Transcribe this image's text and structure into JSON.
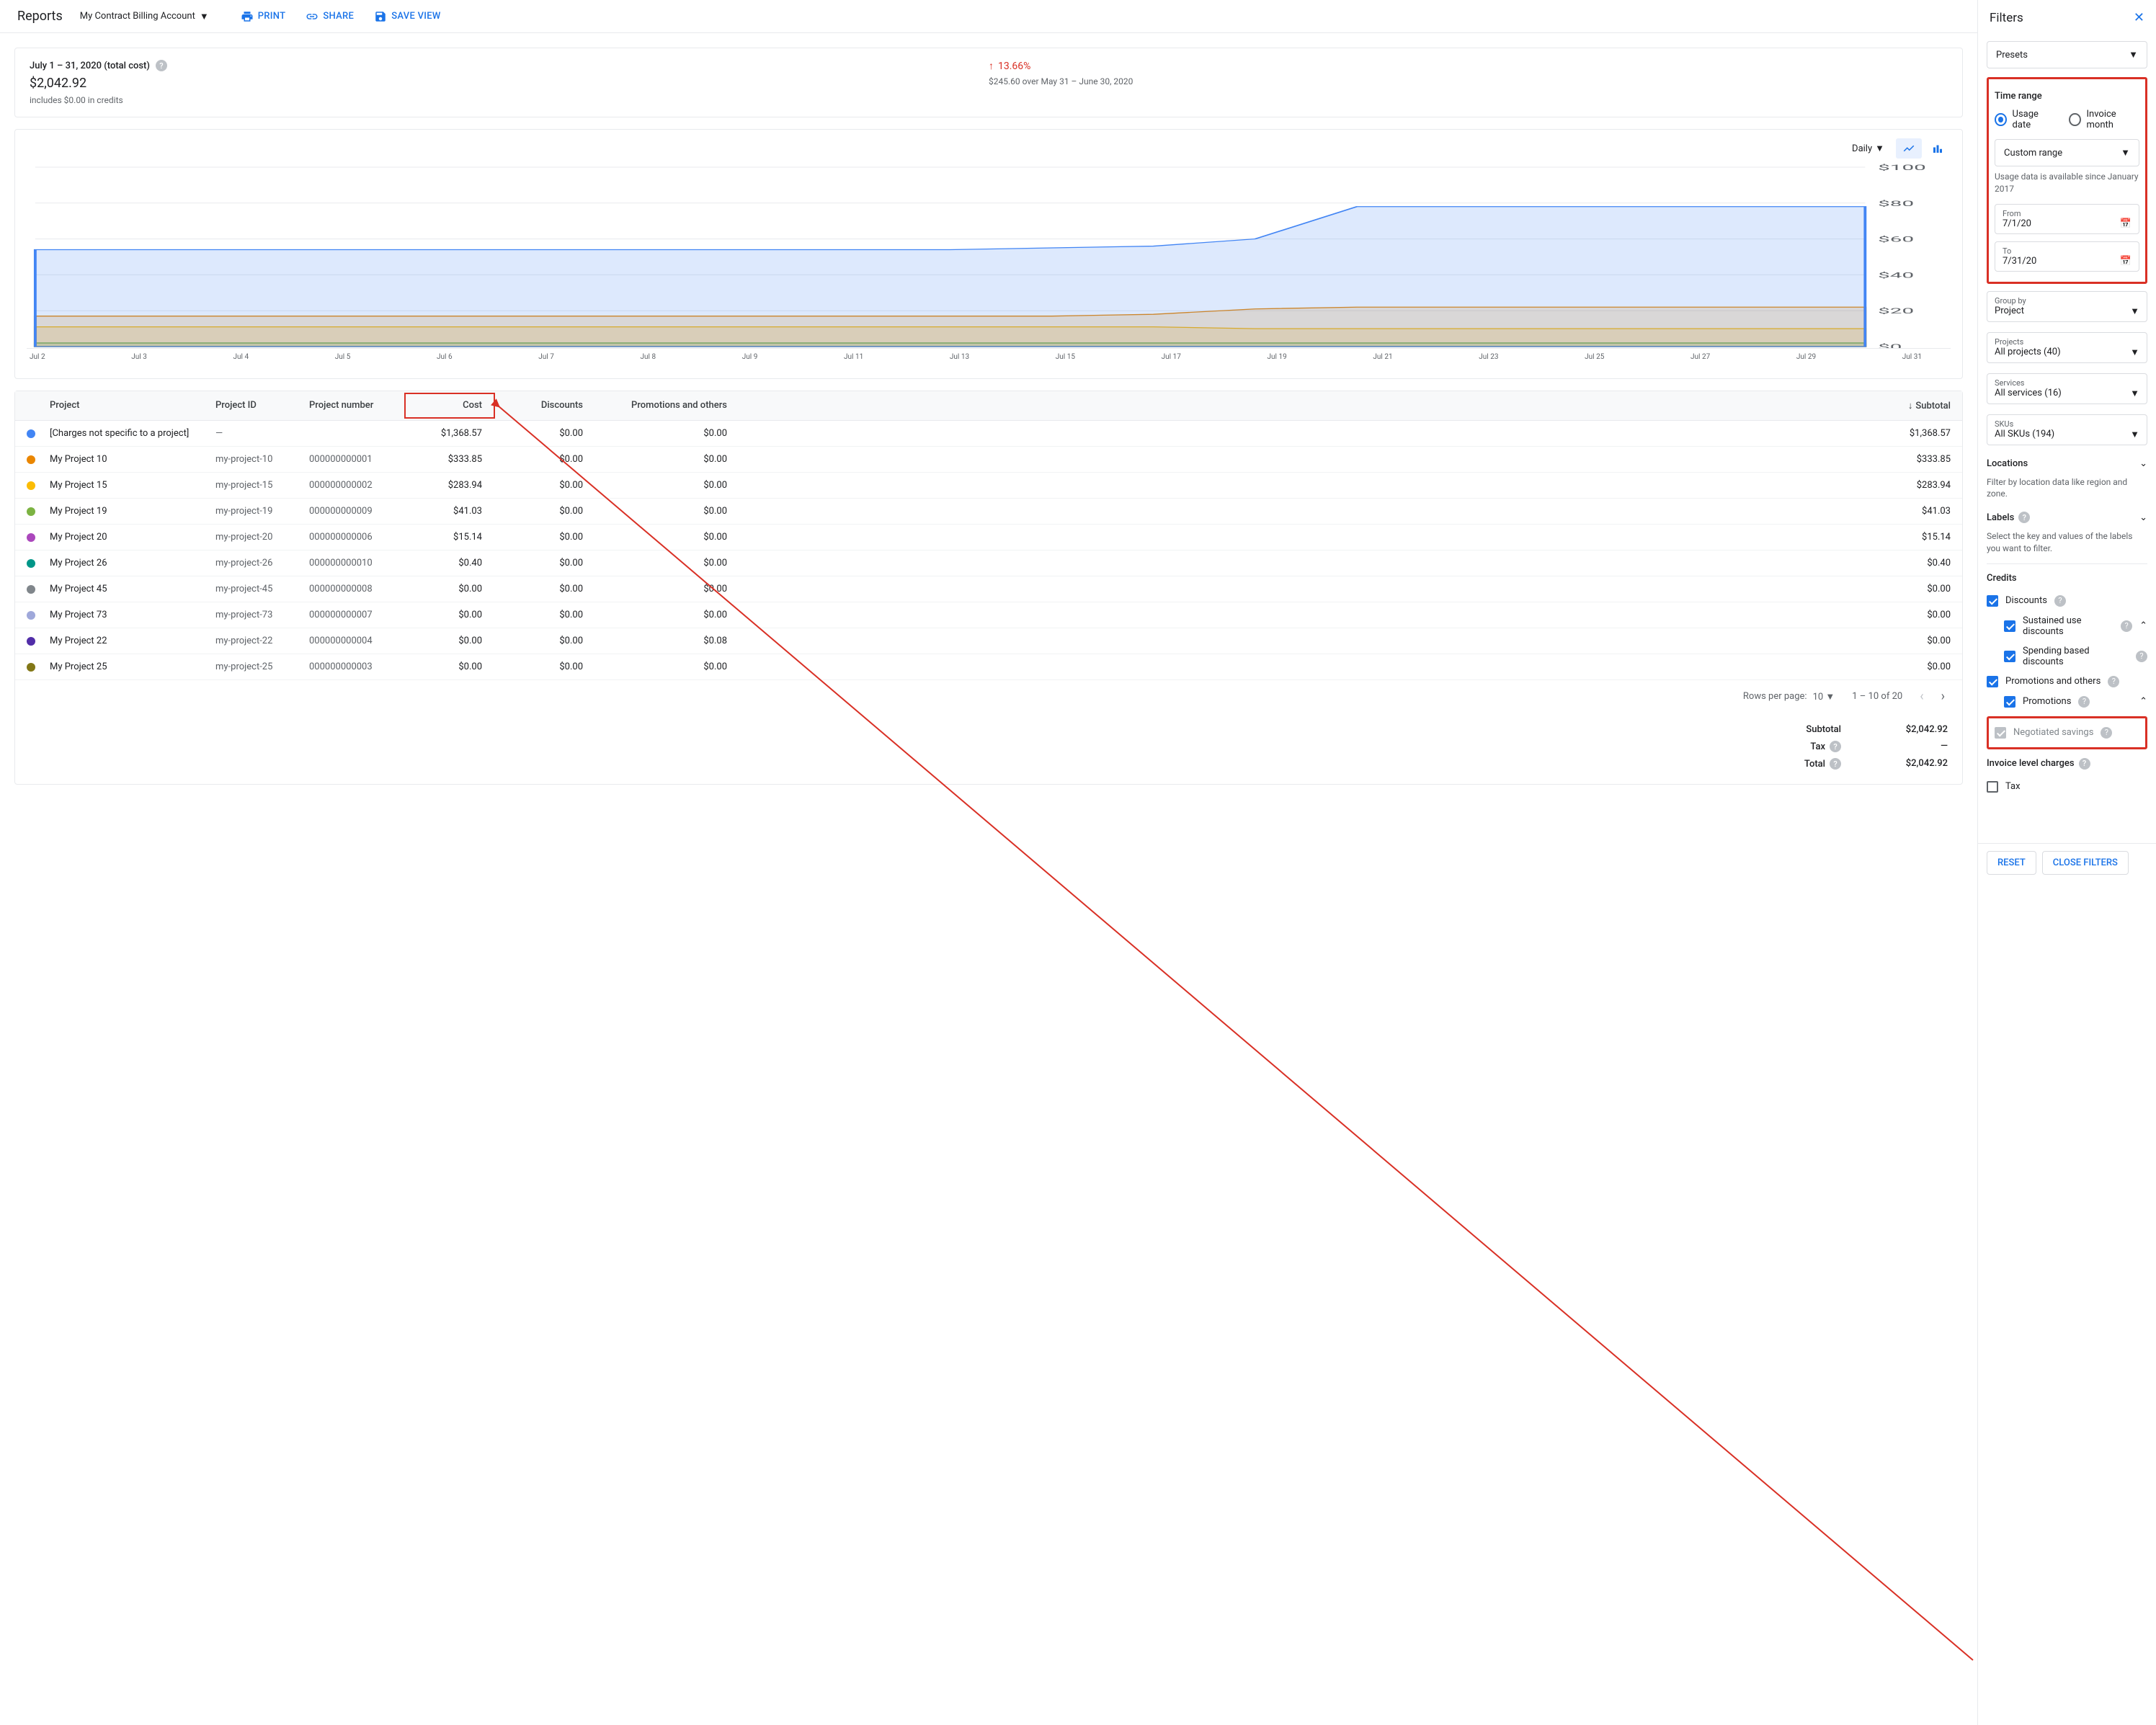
{
  "header": {
    "title": "Reports",
    "account": "My Contract Billing Account",
    "print": "PRINT",
    "share": "SHARE",
    "save_view": "SAVE VIEW"
  },
  "summary": {
    "range_title": "July 1 – 31, 2020 (total cost)",
    "amount": "$2,042.92",
    "credits_note": "includes $0.00 in credits",
    "trend_pct": "13.66%",
    "trend_sub": "$245.60 over May 31 – June 30, 2020"
  },
  "chart_toolbar": {
    "granularity": "Daily"
  },
  "chart_data": {
    "type": "area",
    "ylabel": "$",
    "ylim": [
      0,
      100
    ],
    "yticks": [
      "$0",
      "$20",
      "$40",
      "$60",
      "$80",
      "$100"
    ],
    "x": [
      "Jul 2",
      "Jul 3",
      "Jul 4",
      "Jul 5",
      "Jul 6",
      "Jul 7",
      "Jul 8",
      "Jul 9",
      "Jul 11",
      "Jul 13",
      "Jul 15",
      "Jul 17",
      "Jul 19",
      "Jul 21",
      "Jul 23",
      "Jul 25",
      "Jul 27",
      "Jul 29",
      "Jul 31"
    ],
    "series": [
      {
        "name": "[Charges not specific to a project]",
        "color": "#4285f4",
        "values": [
          54,
          54,
          54,
          54,
          54,
          54,
          54,
          54,
          54,
          54,
          55,
          56,
          60,
          78,
          78,
          78,
          78,
          78,
          78
        ]
      },
      {
        "name": "My Project 10",
        "color": "#ea8600",
        "values": [
          17,
          17,
          17,
          17,
          17,
          17,
          17,
          17,
          17,
          17,
          17,
          18,
          21,
          22,
          22,
          22,
          22,
          22,
          22
        ]
      },
      {
        "name": "My Project 15",
        "color": "#fbbc04",
        "values": [
          11,
          11,
          11,
          11,
          11,
          11,
          11,
          11,
          11,
          11,
          11,
          11,
          10,
          10,
          10,
          10,
          10,
          10,
          10
        ]
      },
      {
        "name": "My Project 19",
        "color": "#34a853",
        "values": [
          2,
          2,
          2,
          2,
          2,
          2,
          2,
          2,
          2,
          2,
          2,
          2,
          2,
          2,
          2,
          2,
          2,
          2,
          2
        ]
      }
    ]
  },
  "table": {
    "headers": {
      "project": "Project",
      "pid": "Project ID",
      "pnum": "Project number",
      "cost": "Cost",
      "disc": "Discounts",
      "promo": "Promotions and others",
      "sub": "Subtotal"
    },
    "rows": [
      {
        "dot": "#4285f4",
        "project": "[Charges not specific to a project]",
        "pid": "—",
        "pnum": "",
        "cost": "$1,368.57",
        "disc": "$0.00",
        "promo": "$0.00",
        "sub": "$1,368.57"
      },
      {
        "dot": "#ea8600",
        "project": "My Project 10",
        "pid": "my-project-10",
        "pnum": "000000000001",
        "cost": "$333.85",
        "disc": "$0.00",
        "promo": "$0.00",
        "sub": "$333.85"
      },
      {
        "dot": "#fbbc04",
        "project": "My Project 15",
        "pid": "my-project-15",
        "pnum": "000000000002",
        "cost": "$283.94",
        "disc": "$0.00",
        "promo": "$0.00",
        "sub": "$283.94"
      },
      {
        "dot": "#7cb342",
        "project": "My Project 19",
        "pid": "my-project-19",
        "pnum": "000000000009",
        "cost": "$41.03",
        "disc": "$0.00",
        "promo": "$0.00",
        "sub": "$41.03"
      },
      {
        "dot": "#ab47bc",
        "project": "My Project 20",
        "pid": "my-project-20",
        "pnum": "000000000006",
        "cost": "$15.14",
        "disc": "$0.00",
        "promo": "$0.00",
        "sub": "$15.14"
      },
      {
        "dot": "#009688",
        "project": "My Project 26",
        "pid": "my-project-26",
        "pnum": "000000000010",
        "cost": "$0.40",
        "disc": "$0.00",
        "promo": "$0.00",
        "sub": "$0.40"
      },
      {
        "dot": "#80868b",
        "project": "My Project 45",
        "pid": "my-project-45",
        "pnum": "000000000008",
        "cost": "$0.00",
        "disc": "$0.00",
        "promo": "$0.00",
        "sub": "$0.00"
      },
      {
        "dot": "#9fa8da",
        "project": "My Project 73",
        "pid": "my-project-73",
        "pnum": "000000000007",
        "cost": "$0.00",
        "disc": "$0.00",
        "promo": "$0.00",
        "sub": "$0.00"
      },
      {
        "dot": "#512da8",
        "project": "My Project 22",
        "pid": "my-project-22",
        "pnum": "000000000004",
        "cost": "$0.00",
        "disc": "$0.00",
        "promo": "$0.08",
        "sub": "$0.00"
      },
      {
        "dot": "#827717",
        "project": "My Project 25",
        "pid": "my-project-25",
        "pnum": "000000000003",
        "cost": "$0.00",
        "disc": "$0.00",
        "promo": "$0.00",
        "sub": "$0.00"
      }
    ],
    "pager": {
      "rpp_label": "Rows per page:",
      "rpp": "10",
      "range": "1 – 10 of 20"
    },
    "totals": {
      "subtotal_l": "Subtotal",
      "subtotal_v": "$2,042.92",
      "tax_l": "Tax",
      "tax_v": "—",
      "total_l": "Total",
      "total_v": "$2,042.92"
    }
  },
  "filters": {
    "title": "Filters",
    "presets": "Presets",
    "time_range": "Time range",
    "usage_date": "Usage date",
    "invoice_month": "Invoice month",
    "custom_range": "Custom range",
    "usage_note": "Usage data is available since January 2017",
    "from_l": "From",
    "from_v": "7/1/20",
    "to_l": "To",
    "to_v": "7/31/20",
    "group_by_l": "Group by",
    "group_by_v": "Project",
    "projects_l": "Projects",
    "projects_v": "All projects (40)",
    "services_l": "Services",
    "services_v": "All services (16)",
    "skus_l": "SKUs",
    "skus_v": "All SKUs (194)",
    "locations_l": "Locations",
    "locations_h": "Filter by location data like region and zone.",
    "labels_l": "Labels",
    "labels_h": "Select the key and values of the labels you want to filter.",
    "credits_l": "Credits",
    "discounts_l": "Discounts",
    "sus_l": "Sustained use discounts",
    "spend_l": "Spending based discounts",
    "promo_l": "Promotions and others",
    "promos_l": "Promotions",
    "neg_l": "Negotiated savings",
    "ilc_l": "Invoice level charges",
    "tax_cb": "Tax",
    "reset": "RESET",
    "close": "CLOSE FILTERS"
  }
}
